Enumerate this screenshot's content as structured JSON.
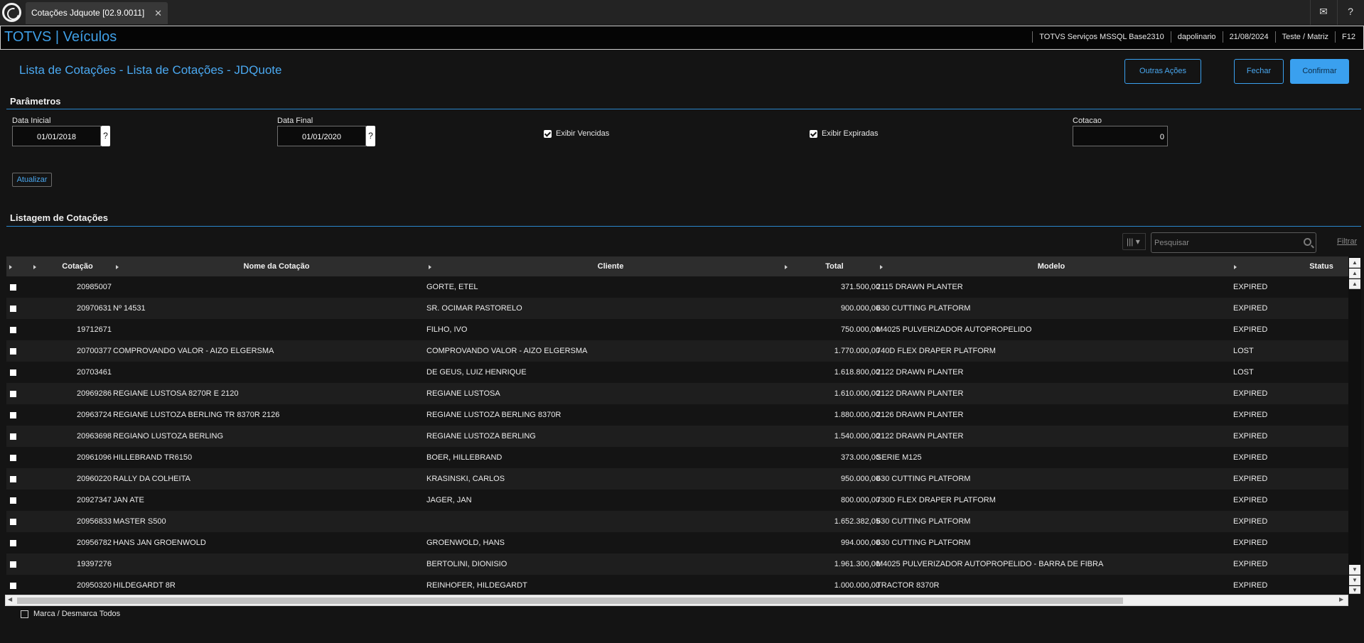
{
  "tabbar": {
    "tab_title": "Cotações Jdquote [02.9.0011]",
    "tab_close": "✕",
    "icons": [
      "mail-icon",
      "help-icon"
    ]
  },
  "header": {
    "brand": "TOTVS | Veículos",
    "server": "TOTVS Serviços MSSQL Base2310",
    "user": "dapolinario",
    "date": "21/08/2024",
    "branch": "Teste / Matriz",
    "hotkey": "F12"
  },
  "page": {
    "title": "Lista de Cotações - Lista de Cotações - JDQuote",
    "actions": {
      "other": "Outras Ações",
      "close": "Fechar",
      "confirm": "Confirmar"
    }
  },
  "params": {
    "section_title": "Parâmetros",
    "data_inicial_label": "Data Inicial",
    "data_inicial_value": "01/01/2018",
    "data_final_label": "Data Final",
    "data_final_value": "01/01/2020",
    "help_glyph": "?",
    "exibir_vencidas_label": "Exibir Vencidas",
    "exibir_expiradas_label": "Exibir Expiradas",
    "cotacao_label": "Cotacao",
    "cotacao_value": "0",
    "refresh_button": "Atualizar"
  },
  "listing": {
    "section_title": "Listagem de Cotações",
    "search_placeholder": "Pesquisar",
    "filter_link": "Filtrar",
    "columns": {
      "cotacao": "Cotação",
      "nome": "Nome da Cotação",
      "cliente": "Cliente",
      "total": "Total",
      "modelo": "Modelo",
      "status": "Status"
    },
    "rows": [
      {
        "cotacao": "20985007",
        "nome": "",
        "cliente": "GORTE, ETEL",
        "total": "371.500,00",
        "modelo": "2115 DRAWN PLANTER",
        "status": "EXPIRED"
      },
      {
        "cotacao": "20970631",
        "nome": "Nº 14531",
        "cliente": "SR. OCIMAR PASTORELO",
        "total": "900.000,00",
        "modelo": "630 CUTTING PLATFORM",
        "status": "EXPIRED"
      },
      {
        "cotacao": "19712671",
        "nome": "",
        "cliente": "FILHO, IVO",
        "total": "750.000,00",
        "modelo": "M4025 PULVERIZADOR AUTOPROPELIDO",
        "status": "EXPIRED"
      },
      {
        "cotacao": "20700377",
        "nome": "COMPROVANDO VALOR - AIZO ELGERSMA",
        "cliente": "COMPROVANDO VALOR - AIZO ELGERSMA",
        "total": "1.770.000,00",
        "modelo": "740D FLEX DRAPER PLATFORM",
        "status": "LOST"
      },
      {
        "cotacao": "20703461",
        "nome": "",
        "cliente": "DE GEUS, LUIZ HENRIQUE",
        "total": "1.618.800,00",
        "modelo": "2122 DRAWN PLANTER",
        "status": "LOST"
      },
      {
        "cotacao": "20969286",
        "nome": "REGIANE LUSTOSA 8270R E 2120",
        "cliente": "REGIANE LUSTOSA",
        "total": "1.610.000,00",
        "modelo": "2122 DRAWN PLANTER",
        "status": "EXPIRED"
      },
      {
        "cotacao": "20963724",
        "nome": "REGIANE LUSTOZA BERLING TR 8370R 2126",
        "cliente": "REGIANE LUSTOZA BERLING 8370R",
        "total": "1.880.000,00",
        "modelo": "2126 DRAWN PLANTER",
        "status": "EXPIRED"
      },
      {
        "cotacao": "20963698",
        "nome": "REGIANO LUSTOZA BERLING",
        "cliente": "REGIANE LUSTOZA BERLING",
        "total": "1.540.000,00",
        "modelo": "2122 DRAWN PLANTER",
        "status": "EXPIRED"
      },
      {
        "cotacao": "20961096",
        "nome": "HILLEBRAND TR6150",
        "cliente": "BOER, HILLEBRAND",
        "total": "373.000,00",
        "modelo": "SERIE M125",
        "status": "EXPIRED"
      },
      {
        "cotacao": "20960220",
        "nome": "RALLY DA COLHEITA",
        "cliente": "KRASINSKI, CARLOS",
        "total": "950.000,00",
        "modelo": "630 CUTTING PLATFORM",
        "status": "EXPIRED"
      },
      {
        "cotacao": "20927347",
        "nome": "JAN ATE",
        "cliente": "JAGER, JAN",
        "total": "800.000,00",
        "modelo": "730D FLEX DRAPER PLATFORM",
        "status": "EXPIRED"
      },
      {
        "cotacao": "20956833",
        "nome": "MASTER S500",
        "cliente": "",
        "total": "1.652.382,05",
        "modelo": "630 CUTTING PLATFORM",
        "status": "EXPIRED"
      },
      {
        "cotacao": "20956782",
        "nome": "HANS JAN GROENWOLD",
        "cliente": "GROENWOLD, HANS",
        "total": "994.000,00",
        "modelo": "630 CUTTING PLATFORM",
        "status": "EXPIRED"
      },
      {
        "cotacao": "19397276",
        "nome": "",
        "cliente": "BERTOLINI, DIONISIO",
        "total": "1.961.300,00",
        "modelo": "M4025 PULVERIZADOR AUTOPROPELIDO - BARRA DE FIBRA",
        "status": "EXPIRED"
      },
      {
        "cotacao": "20950320",
        "nome": "HILDEGARDT 8R",
        "cliente": "REINHOFER, HILDEGARDT",
        "total": "1.000.000,00",
        "modelo": "TRACTOR 8370R",
        "status": "EXPIRED"
      }
    ],
    "select_all_label": "Marca / Desmarca Todos"
  },
  "colors": {
    "accent": "#3aa0ef",
    "background": "#141414",
    "row_alt": "#1e1e1e"
  }
}
